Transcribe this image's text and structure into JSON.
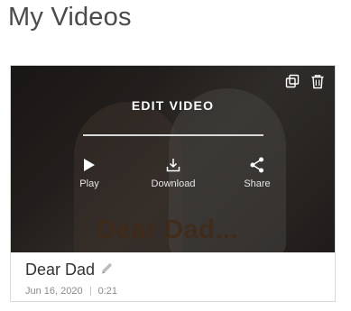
{
  "page": {
    "title": "My Videos"
  },
  "video": {
    "edit_label": "EDIT VIDEO",
    "caption": "Dear Dad...",
    "title": "Dear Dad",
    "date": "Jun 16, 2020",
    "duration": "0:21",
    "actions": [
      {
        "label": "Play",
        "icon": "play-icon"
      },
      {
        "label": "Download",
        "icon": "download-icon"
      },
      {
        "label": "Share",
        "icon": "share-icon"
      }
    ],
    "top_icons": [
      "duplicate-icon",
      "trash-icon"
    ]
  },
  "colors": {
    "title_text": "#4a4a4a",
    "overlay_text": "#ffffff",
    "meta_text": "#8a8a8a",
    "card_border": "#d9d9d9"
  }
}
